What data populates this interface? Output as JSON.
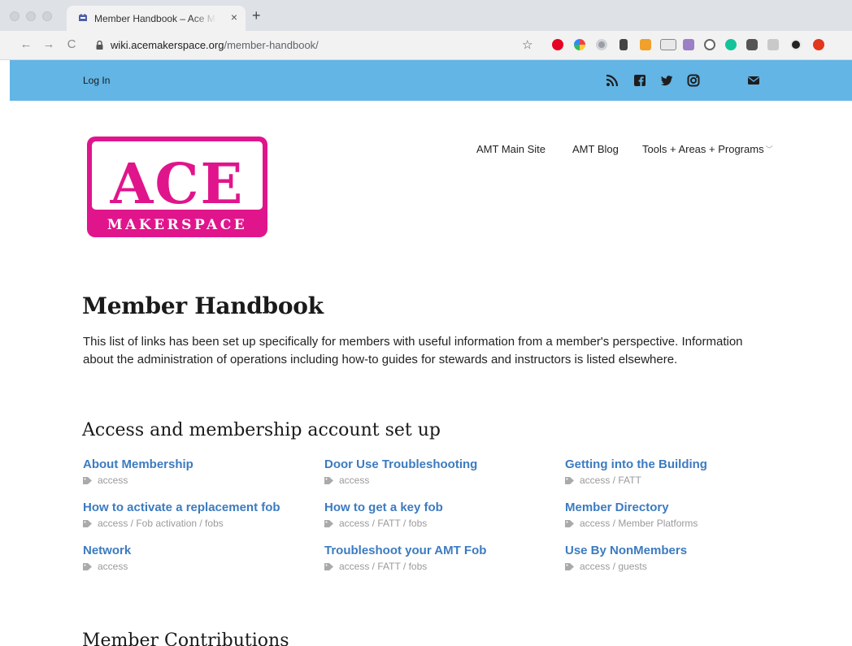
{
  "browser": {
    "tab_title": "Member Handbook – Ace Makerspace",
    "tab_close": "×",
    "new_tab": "+",
    "back": "←",
    "forward": "→",
    "reload": "C",
    "url_host": "wiki.acemakerspace.org",
    "url_path": "/member-handbook/",
    "bookmark": "☆",
    "extensions": [
      "pinterest",
      "colorful-circle",
      "dot-circle",
      "ublock",
      "dark-card",
      "rss",
      "new-badge",
      "purple-square",
      "info",
      "grammarly",
      "puzzle",
      "playlist",
      "avatar",
      "adblock"
    ],
    "extension_badge": "new"
  },
  "topbar": {
    "login": "Log In",
    "social": [
      "rss-icon",
      "facebook-icon",
      "twitter-icon",
      "instagram-icon",
      "email-icon"
    ],
    "color": "#62b5e5"
  },
  "logo": {
    "word": "ACE",
    "subword": "MAKERSPACE",
    "color": "#e0158c"
  },
  "nav": [
    {
      "label": "AMT Main Site"
    },
    {
      "label": "AMT Blog"
    },
    {
      "label": "Tools + Areas + Programs",
      "has_dropdown": true
    }
  ],
  "page": {
    "title": "Member Handbook",
    "intro": "This list of links has been set up specifically for members with useful information from a member's perspective. Information about the administration of operations including how-to guides for stewards and instructors is listed elsewhere."
  },
  "sections": [
    {
      "heading": "Access and membership account set up",
      "items": [
        {
          "title": "About Membership",
          "tags": "access"
        },
        {
          "title": "Door Use Troubleshooting",
          "tags": "access"
        },
        {
          "title": "Getting into the Building",
          "tags": "access / FATT"
        },
        {
          "title": "How to activate a replacement fob",
          "tags": "access / Fob activation / fobs"
        },
        {
          "title": "How to get a key fob",
          "tags": "access / FATT / fobs"
        },
        {
          "title": "Member Directory",
          "tags": "access / Member Platforms"
        },
        {
          "title": "Network",
          "tags": "access"
        },
        {
          "title": "Troubleshoot your AMT Fob",
          "tags": "access / FATT / fobs"
        },
        {
          "title": "Use By NonMembers",
          "tags": "access / guests"
        }
      ]
    },
    {
      "heading": "Member Contributions",
      "items": []
    }
  ],
  "colors": {
    "link": "#3c7bc0",
    "tag": "#9a9a9a"
  }
}
